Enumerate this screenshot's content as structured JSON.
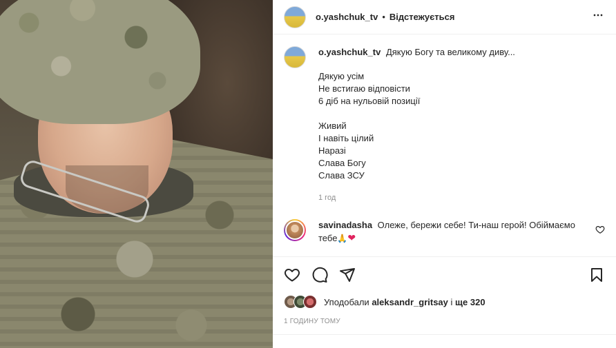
{
  "header": {
    "username": "o.yashchuk_tv",
    "separator": "•",
    "follow_status": "Відстежується",
    "more_icon": "more-horizontal-icon"
  },
  "caption": {
    "username": "o.yashchuk_tv",
    "first_line": "Дякую Богу та великому диву...",
    "lines": [
      "Дякую усім",
      "Не встигаю відповісти",
      "6 діб на нульовій позиції",
      "",
      "Живий",
      "І навіть цілий",
      "Наразі",
      "Слава Богу",
      "Слава ЗСУ"
    ],
    "time": "1 год"
  },
  "comment": {
    "username": "savinadasha",
    "text": "Олеже, бережи себе! Ти-наш герой! Обіймаємо тебе",
    "emoji": "🙏",
    "heart": "❤"
  },
  "actions": {
    "like_icon": "heart-icon",
    "comment_icon": "comment-icon",
    "share_icon": "share-icon",
    "save_icon": "bookmark-icon"
  },
  "likes": {
    "prefix": "Уподобали",
    "user": "aleksandr_gritsay",
    "middle": "і",
    "count": "ще 320"
  },
  "post_date": "1 ГОДИНУ ТОМУ"
}
